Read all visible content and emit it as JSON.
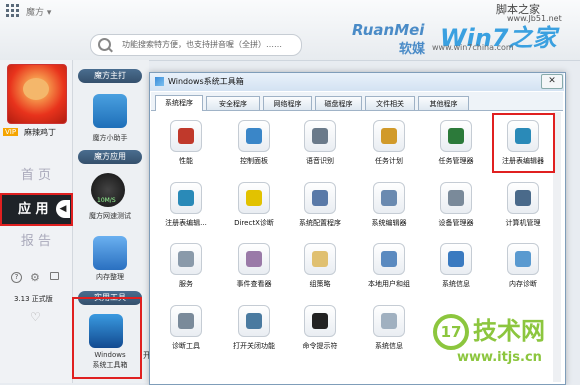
{
  "app": {
    "title": "魔方 ▾"
  },
  "search": {
    "placeholder": "功能搜索特方便，也支持拼音喔（全拼）……"
  },
  "brand": {
    "ruanmei": "RuanMei",
    "ruanmei_cn": "软媒",
    "win7": "Win7之家",
    "url": "www.win7china.com"
  },
  "watermark_top": {
    "line1": "脚本之家",
    "line2": "www.Jb51.net"
  },
  "profile": {
    "vip": "VIP",
    "username": "麻辣鸡丁"
  },
  "nav": {
    "home": "首 页",
    "app": "应 用",
    "report": "报 告",
    "arrow": "◀"
  },
  "footer": {
    "help": "?",
    "gear": "⚙",
    "version": "3.13 正式版",
    "heart": "♡"
  },
  "sections": {
    "main": "魔方主打",
    "apps": "魔方应用",
    "tools": "实用工具"
  },
  "main_items": [
    {
      "label": "魔方小助手"
    },
    {
      "label": "魔方网速测试",
      "badge": "10M/S"
    },
    {
      "label": "内存整理"
    },
    {
      "label": "Windows\n系统工具箱"
    }
  ],
  "extra_char": "开",
  "dialog": {
    "title": "Windows系统工具箱",
    "close": "✕",
    "tabs": [
      "系统程序",
      "安全程序",
      "网络程序",
      "磁盘程序",
      "文件相关",
      "其他程序"
    ],
    "active_tab": 0,
    "tools": [
      {
        "label": "性能",
        "color": "#c0392b"
      },
      {
        "label": "控制面板",
        "color": "#3a86c8"
      },
      {
        "label": "语音识别",
        "color": "#6a7a8a"
      },
      {
        "label": "任务计划",
        "color": "#d19a2a"
      },
      {
        "label": "任务管理器",
        "color": "#2c7a3a"
      },
      {
        "label": "注册表编辑器",
        "color": "#2a8ab8"
      },
      {
        "label": "注册表编辑...",
        "color": "#2a8ab8"
      },
      {
        "label": "DirectX诊断",
        "color": "#e2c200"
      },
      {
        "label": "系统配置程序",
        "color": "#5a7aa8"
      },
      {
        "label": "系统编辑器",
        "color": "#6a8ab0"
      },
      {
        "label": "设备管理器",
        "color": "#7a8a9a"
      },
      {
        "label": "计算机管理",
        "color": "#4a6a8a"
      },
      {
        "label": "服务",
        "color": "#8a9aaa"
      },
      {
        "label": "事件查看器",
        "color": "#9a7aa8"
      },
      {
        "label": "组策略",
        "color": "#e0c070"
      },
      {
        "label": "本地用户和组",
        "color": "#5a8ac0"
      },
      {
        "label": "系统信息",
        "color": "#3a7ac0"
      },
      {
        "label": "内存诊断",
        "color": "#5a9ad0"
      },
      {
        "label": "诊断工具",
        "color": "#7a8a9a"
      },
      {
        "label": "打开关闭功能",
        "color": "#4a7aa0"
      },
      {
        "label": "命令提示符",
        "color": "#222222"
      },
      {
        "label": "系统信息",
        "color": "#a0b0c0"
      }
    ]
  },
  "watermark_bottom": {
    "logo": "17",
    "brand": "技术网",
    "url": "www.itjs.cn"
  }
}
